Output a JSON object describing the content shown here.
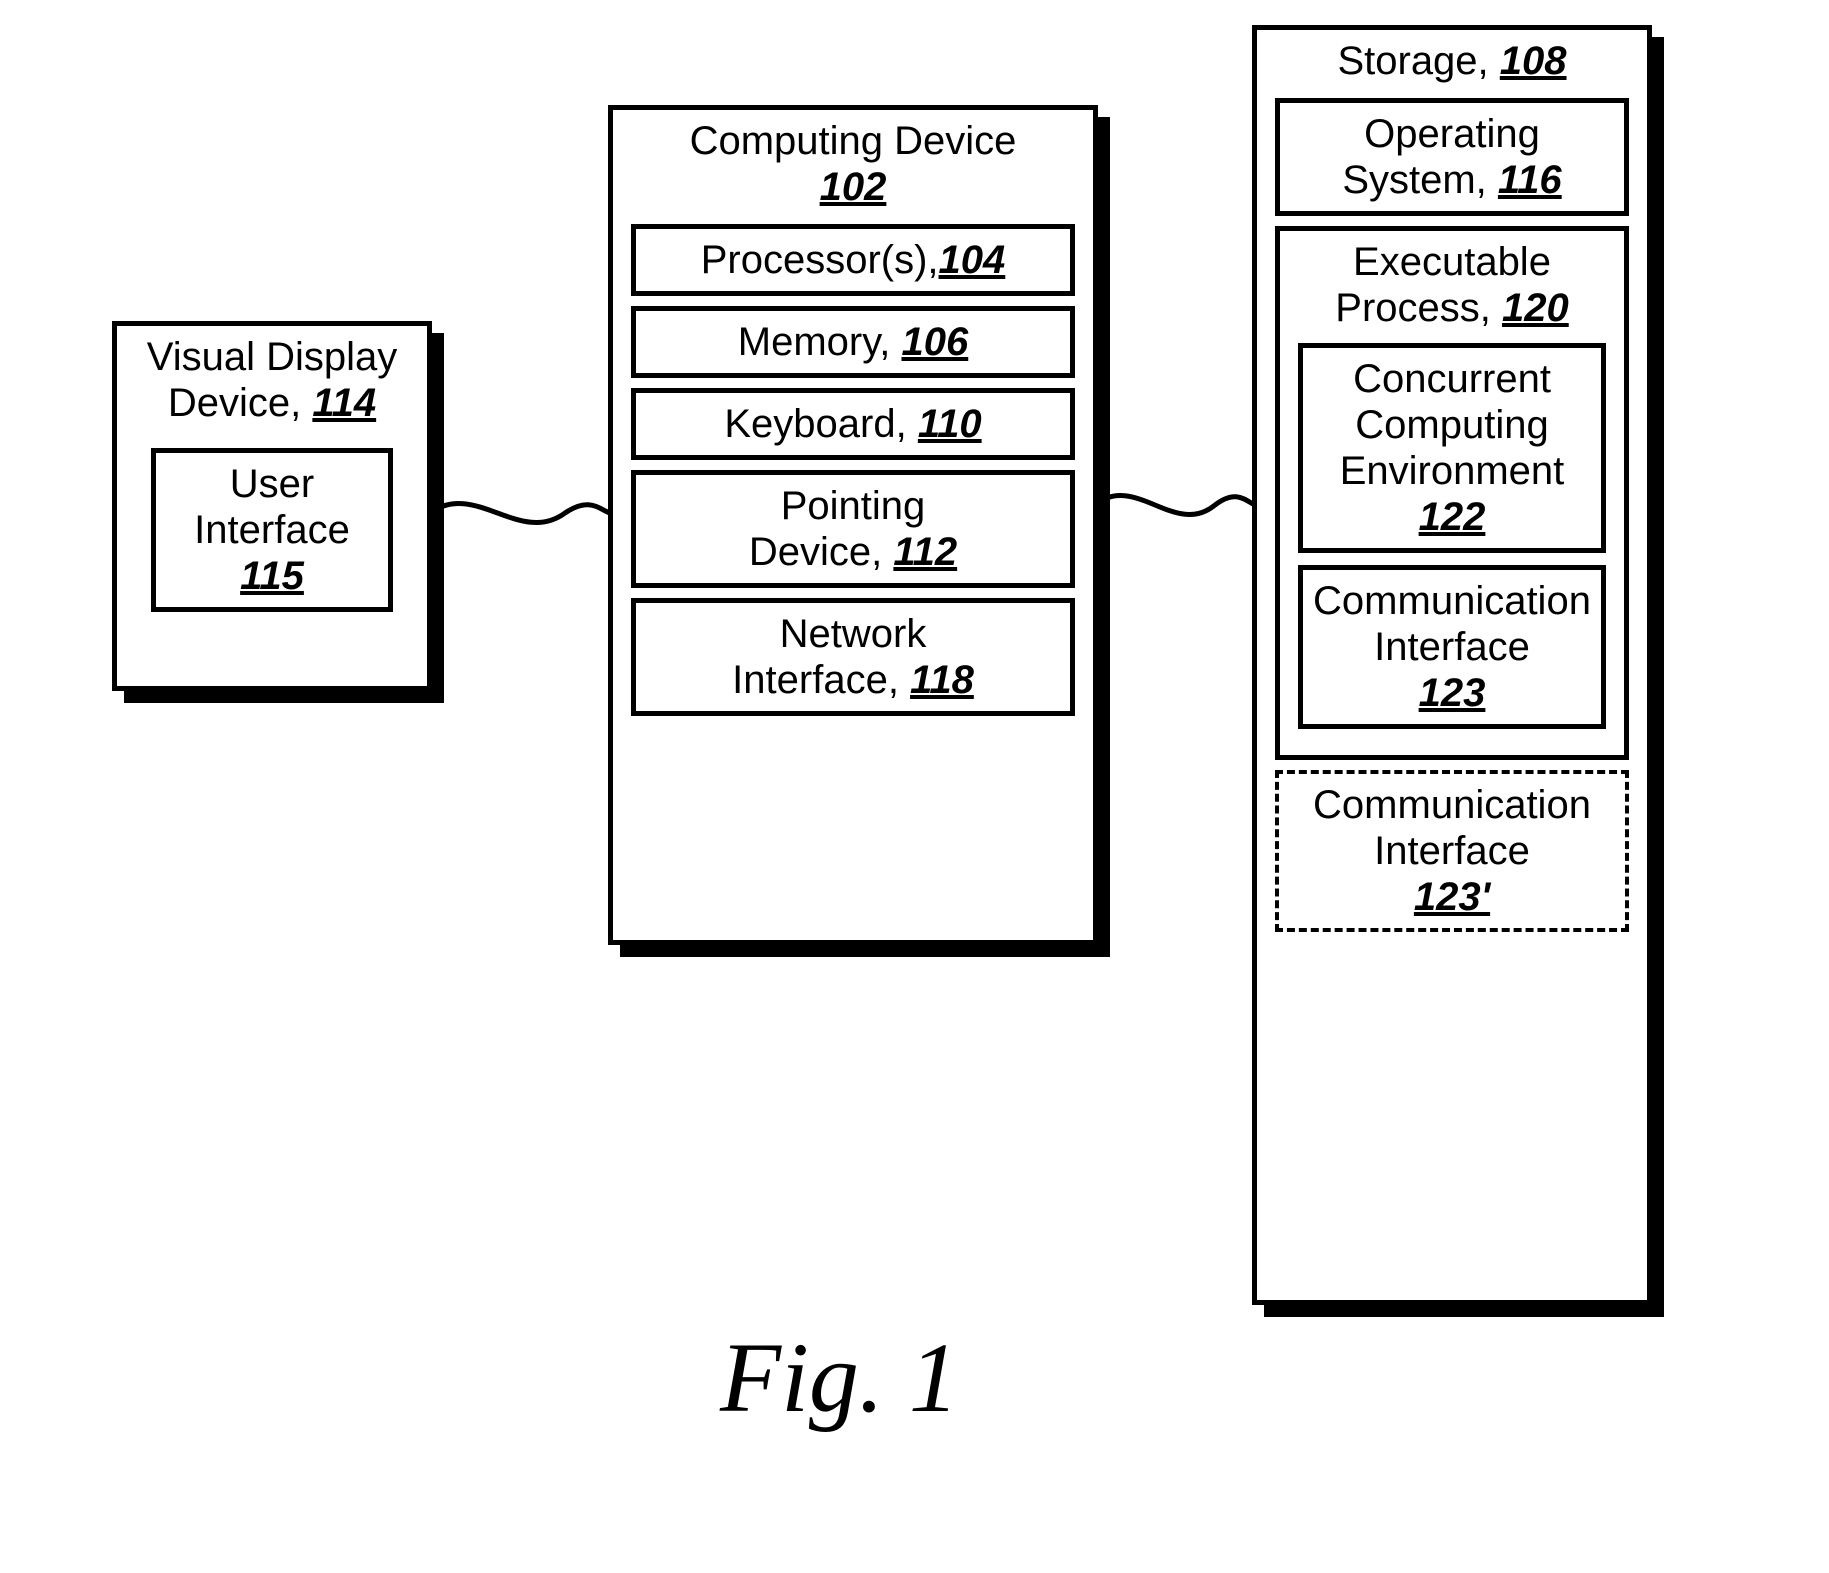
{
  "figureLabel": "Fig. 1",
  "display": {
    "titleLine1": "Visual Display",
    "titleLine2": "Device, ",
    "ref": "114",
    "ui": {
      "line1": "User",
      "line2": "Interface",
      "ref": "115"
    }
  },
  "computing": {
    "titleLine1": "Computing Device",
    "ref": "102",
    "processor": {
      "label": "Processor(s),",
      "ref": "104"
    },
    "memory": {
      "label": "Memory, ",
      "ref": "106"
    },
    "keyboard": {
      "label": "Keyboard, ",
      "ref": "110"
    },
    "pointing": {
      "line1": "Pointing",
      "line2": "Device, ",
      "ref": "112"
    },
    "network": {
      "line1": "Network",
      "line2": "Interface, ",
      "ref": "118"
    }
  },
  "storage": {
    "titleLabel": "Storage, ",
    "ref": "108",
    "os": {
      "line1": "Operating",
      "line2": "System, ",
      "ref": "116"
    },
    "exec": {
      "line1": "Executable",
      "line2": "Process, ",
      "ref": "120",
      "cce": {
        "line1": "Concurrent",
        "line2": "Computing",
        "line3": "Environment",
        "ref": "122"
      },
      "comm": {
        "line1": "Communication",
        "line2": "Interface",
        "ref": "123"
      }
    },
    "commAlt": {
      "line1": "Communication",
      "line2": "Interface",
      "ref": "123'"
    }
  }
}
